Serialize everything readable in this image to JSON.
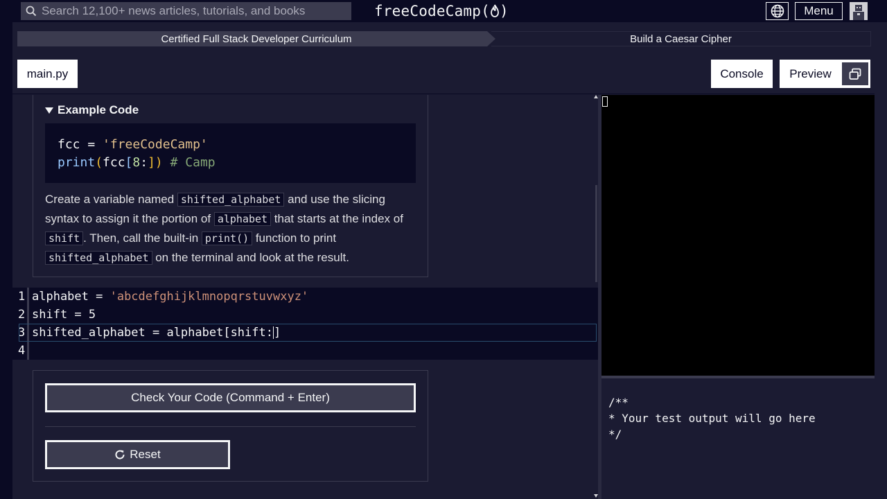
{
  "nav": {
    "search_placeholder": "Search 12,100+ news articles, tutorials, and books",
    "logo_text": "freeCodeCamp(",
    "logo_close": ")",
    "menu_label": "Menu"
  },
  "breadcrumb": {
    "course": "Certified Full Stack Developer Curriculum",
    "lesson": "Build a Caesar Cipher"
  },
  "tabs": {
    "file": "main.py",
    "console": "Console",
    "preview": "Preview"
  },
  "instructions": {
    "summary": "Example Code",
    "example_line1_var": "fcc",
    "example_line1_op": " = ",
    "example_line1_str": "'freeCodeCamp'",
    "example_line2_fn": "print",
    "example_line2_open": "(",
    "example_line2_arg": "fcc",
    "example_line2_bopen": "[",
    "example_line2_num": "8",
    "example_line2_colon": ":",
    "example_line2_bclose": "])",
    "example_line2_comment": " # Camp",
    "desc_1": "Create a variable named ",
    "code_1": "shifted_alphabet",
    "desc_2": " and use the slicing syntax to assign it the portion of ",
    "code_2": "alphabet",
    "desc_3": " that starts at the index of ",
    "code_3": "shift",
    "desc_4": ". Then, call the built-in ",
    "code_4": "print()",
    "desc_5": " function to print ",
    "code_5": "shifted_alphabet",
    "desc_6": " on the terminal and look at the result."
  },
  "editor": {
    "line_numbers": [
      "1",
      "2",
      "3",
      "4"
    ],
    "line1_code": "alphabet = ",
    "line1_str": "'abcdefghijklmnopqrstuvwxyz'",
    "line2": "shift = 5",
    "line3": "shifted_alphabet = alphabet[shift:]",
    "line4": ""
  },
  "buttons": {
    "check": "Check Your Code (Command + Enter)",
    "reset": "Reset"
  },
  "console": {
    "output": "/**\n* Your test output will go here\n*/"
  }
}
